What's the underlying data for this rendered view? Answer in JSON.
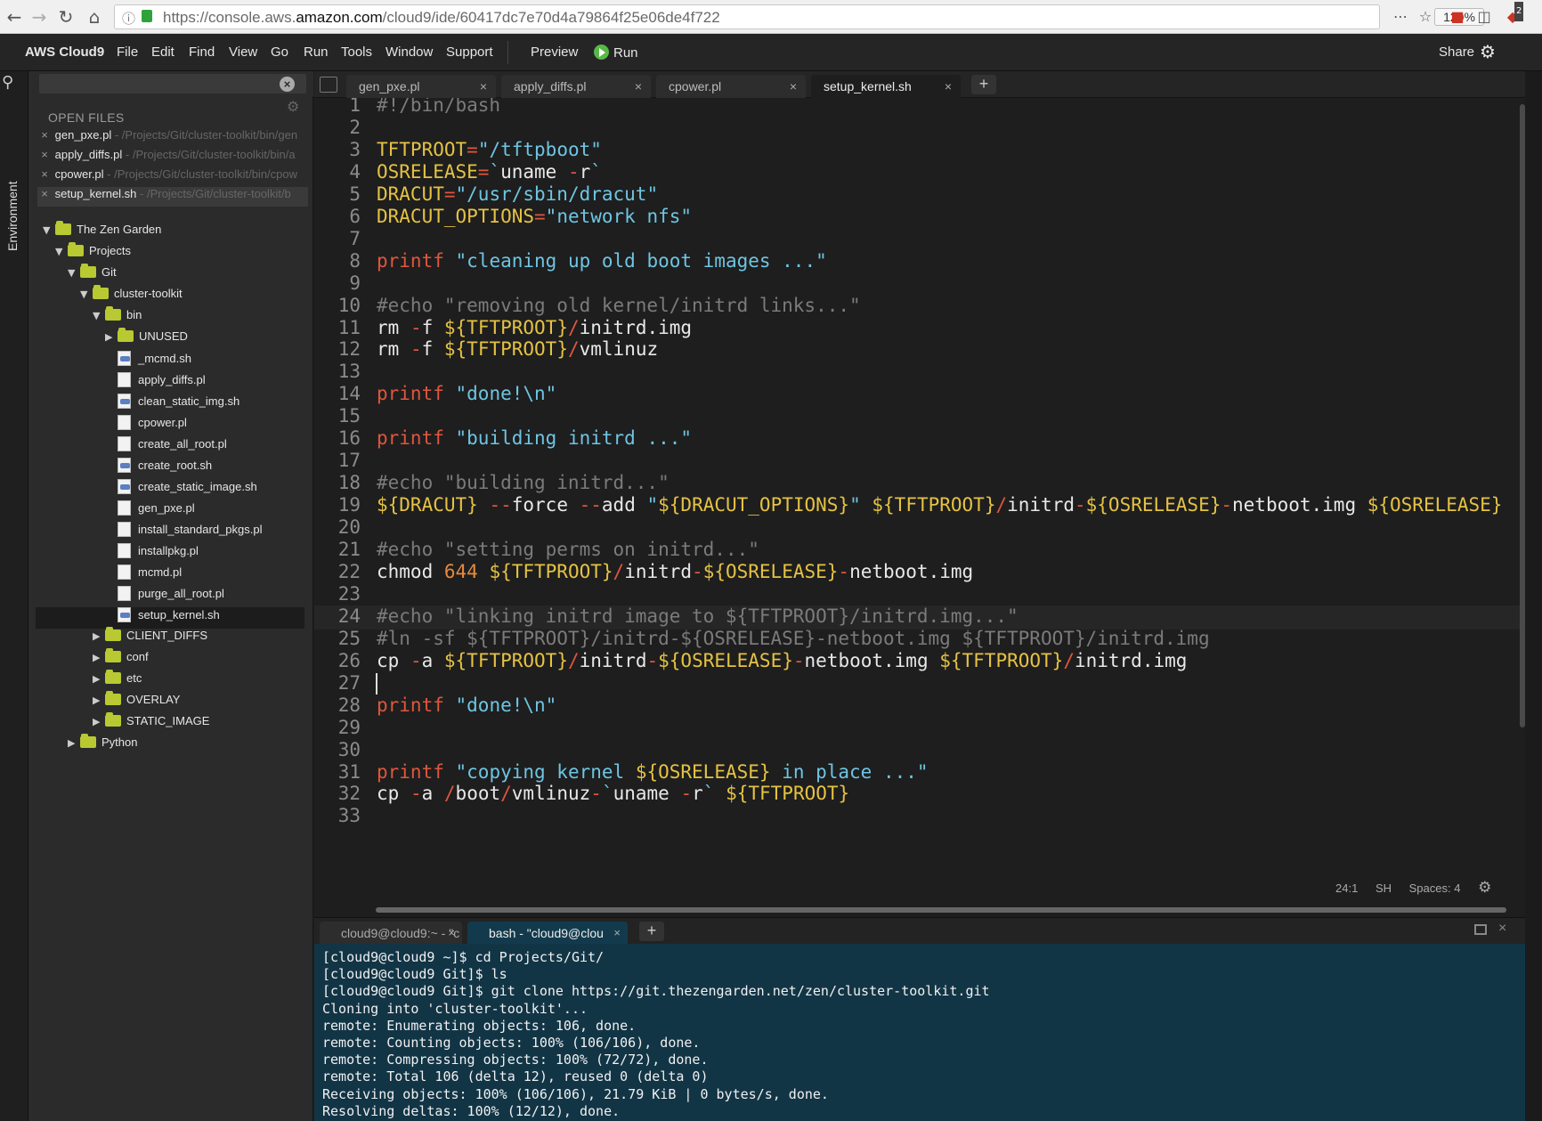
{
  "browser": {
    "url_prefix": "https://console.aws.",
    "url_domain": "amazon.com",
    "url_path": "/cloud9/ide/60417dc7e70d4a79864f25e06de4f722",
    "zoom": "120%",
    "badge": "2"
  },
  "menu": {
    "brand": "AWS Cloud9",
    "items": [
      "File",
      "Edit",
      "Find",
      "View",
      "Go",
      "Run",
      "Tools",
      "Window",
      "Support"
    ],
    "preview": "Preview",
    "run": "Run",
    "share": "Share"
  },
  "rail": {
    "environment": "Environment"
  },
  "sidebar": {
    "search_placeholder": "",
    "open_files_title": "OPEN FILES",
    "open_files": [
      {
        "name": "gen_pxe.pl",
        "path": " - /Projects/Git/cluster-toolkit/bin/gen"
      },
      {
        "name": "apply_diffs.pl",
        "path": " - /Projects/Git/cluster-toolkit/bin/a"
      },
      {
        "name": "cpower.pl",
        "path": " - /Projects/Git/cluster-toolkit/bin/cpow"
      },
      {
        "name": "setup_kernel.sh",
        "path": " - /Projects/Git/cluster-toolkit/b"
      }
    ],
    "tree": [
      {
        "label": "The Zen Garden",
        "type": "folder",
        "level": 0,
        "open": true
      },
      {
        "label": "Projects",
        "type": "folder",
        "level": 1,
        "open": true
      },
      {
        "label": "Git",
        "type": "folder",
        "level": 2,
        "open": true
      },
      {
        "label": "cluster-toolkit",
        "type": "folder",
        "level": 3,
        "open": true
      },
      {
        "label": "bin",
        "type": "folder",
        "level": 4,
        "open": true
      },
      {
        "label": "UNUSED",
        "type": "folder",
        "level": 5,
        "open": false
      },
      {
        "label": "_mcmd.sh",
        "type": "script",
        "level": 5
      },
      {
        "label": "apply_diffs.pl",
        "type": "file",
        "level": 5
      },
      {
        "label": "clean_static_img.sh",
        "type": "script",
        "level": 5
      },
      {
        "label": "cpower.pl",
        "type": "file",
        "level": 5
      },
      {
        "label": "create_all_root.pl",
        "type": "file",
        "level": 5
      },
      {
        "label": "create_root.sh",
        "type": "script",
        "level": 5
      },
      {
        "label": "create_static_image.sh",
        "type": "script",
        "level": 5
      },
      {
        "label": "gen_pxe.pl",
        "type": "file",
        "level": 5
      },
      {
        "label": "install_standard_pkgs.pl",
        "type": "file",
        "level": 5
      },
      {
        "label": "installpkg.pl",
        "type": "file",
        "level": 5
      },
      {
        "label": "mcmd.pl",
        "type": "file",
        "level": 5
      },
      {
        "label": "purge_all_root.pl",
        "type": "file",
        "level": 5
      },
      {
        "label": "setup_kernel.sh",
        "type": "script",
        "level": 5,
        "selected": true
      },
      {
        "label": "CLIENT_DIFFS",
        "type": "folder",
        "level": 4,
        "open": false
      },
      {
        "label": "conf",
        "type": "folder",
        "level": 4,
        "open": false
      },
      {
        "label": "etc",
        "type": "folder",
        "level": 4,
        "open": false
      },
      {
        "label": "OVERLAY",
        "type": "folder",
        "level": 4,
        "open": false
      },
      {
        "label": "STATIC_IMAGE",
        "type": "folder",
        "level": 4,
        "open": false
      },
      {
        "label": "Python",
        "type": "folder",
        "level": 2,
        "open": false
      }
    ]
  },
  "editor": {
    "tabs": [
      {
        "label": "gen_pxe.pl",
        "active": false
      },
      {
        "label": "apply_diffs.pl",
        "active": false
      },
      {
        "label": "cpower.pl",
        "active": false
      },
      {
        "label": "setup_kernel.sh",
        "active": true
      }
    ],
    "add_tab": "+",
    "current_line": 24,
    "lines": [
      [
        [
          "c",
          "#!/bin/bash"
        ]
      ],
      [],
      [
        [
          "v",
          "TFTPROOT"
        ],
        [
          "o",
          "="
        ],
        [
          "s",
          "\"/tftpboot\""
        ]
      ],
      [
        [
          "v",
          "OSRELEASE"
        ],
        [
          "o",
          "="
        ],
        [
          "s",
          "`"
        ],
        [
          "t",
          "uname "
        ],
        [
          "o",
          "-"
        ],
        [
          "t",
          "r"
        ],
        [
          "s",
          "`"
        ]
      ],
      [
        [
          "v",
          "DRACUT"
        ],
        [
          "o",
          "="
        ],
        [
          "s",
          "\"/usr/sbin/dracut\""
        ]
      ],
      [
        [
          "v",
          "DRACUT_OPTIONS"
        ],
        [
          "o",
          "="
        ],
        [
          "s",
          "\"network nfs\""
        ]
      ],
      [],
      [
        [
          "k",
          "printf"
        ],
        [
          "t",
          " "
        ],
        [
          "s",
          "\"cleaning up old boot images ...\""
        ]
      ],
      [],
      [
        [
          "c",
          "#echo \"removing old kernel/initrd links...\""
        ]
      ],
      [
        [
          "t",
          "rm "
        ],
        [
          "o",
          "-"
        ],
        [
          "t",
          "f "
        ],
        [
          "v",
          "${TFTPROOT}"
        ],
        [
          "o",
          "/"
        ],
        [
          "t",
          "initrd.img"
        ]
      ],
      [
        [
          "t",
          "rm "
        ],
        [
          "o",
          "-"
        ],
        [
          "t",
          "f "
        ],
        [
          "v",
          "${TFTPROOT}"
        ],
        [
          "o",
          "/"
        ],
        [
          "t",
          "vmlinuz"
        ]
      ],
      [],
      [
        [
          "k",
          "printf"
        ],
        [
          "t",
          " "
        ],
        [
          "s",
          "\"done!\\n\""
        ]
      ],
      [],
      [
        [
          "k",
          "printf"
        ],
        [
          "t",
          " "
        ],
        [
          "s",
          "\"building initrd ...\""
        ]
      ],
      [],
      [
        [
          "c",
          "#echo \"building initrd...\""
        ]
      ],
      [
        [
          "v",
          "${DRACUT}"
        ],
        [
          "t",
          " "
        ],
        [
          "o",
          "--"
        ],
        [
          "t",
          "force "
        ],
        [
          "o",
          "--"
        ],
        [
          "t",
          "add "
        ],
        [
          "s",
          "\""
        ],
        [
          "v",
          "${DRACUT_OPTIONS}"
        ],
        [
          "s",
          "\""
        ],
        [
          "t",
          " "
        ],
        [
          "v",
          "${TFTPROOT}"
        ],
        [
          "o",
          "/"
        ],
        [
          "t",
          "initrd"
        ],
        [
          "o",
          "-"
        ],
        [
          "v",
          "${OSRELEASE}"
        ],
        [
          "o",
          "-"
        ],
        [
          "t",
          "netboot.img "
        ],
        [
          "v",
          "${OSRELEASE}"
        ]
      ],
      [],
      [
        [
          "c",
          "#echo \"setting perms on initrd...\""
        ]
      ],
      [
        [
          "t",
          "chmod "
        ],
        [
          "n",
          "644"
        ],
        [
          "t",
          " "
        ],
        [
          "v",
          "${TFTPROOT}"
        ],
        [
          "o",
          "/"
        ],
        [
          "t",
          "initrd"
        ],
        [
          "o",
          "-"
        ],
        [
          "v",
          "${OSRELEASE}"
        ],
        [
          "o",
          "-"
        ],
        [
          "t",
          "netboot.img"
        ]
      ],
      [],
      [
        [
          "c",
          "#echo \"linking initrd image to ${TFTPROOT}/initrd.img...\""
        ]
      ],
      [
        [
          "c",
          "#ln -sf ${TFTPROOT}/initrd-${OSRELEASE}-netboot.img ${TFTPROOT}/initrd.img"
        ]
      ],
      [
        [
          "t",
          "cp "
        ],
        [
          "o",
          "-"
        ],
        [
          "t",
          "a "
        ],
        [
          "v",
          "${TFTPROOT}"
        ],
        [
          "o",
          "/"
        ],
        [
          "t",
          "initrd"
        ],
        [
          "o",
          "-"
        ],
        [
          "v",
          "${OSRELEASE}"
        ],
        [
          "o",
          "-"
        ],
        [
          "t",
          "netboot.img "
        ],
        [
          "v",
          "${TFTPROOT}"
        ],
        [
          "o",
          "/"
        ],
        [
          "t",
          "initrd.img"
        ]
      ],
      [],
      [
        [
          "k",
          "printf"
        ],
        [
          "t",
          " "
        ],
        [
          "s",
          "\"done!\\n\""
        ]
      ],
      [],
      [],
      [
        [
          "k",
          "printf"
        ],
        [
          "t",
          " "
        ],
        [
          "s",
          "\"copying kernel "
        ],
        [
          "v",
          "${OSRELEASE}"
        ],
        [
          "s",
          " in place ...\""
        ]
      ],
      [
        [
          "t",
          "cp "
        ],
        [
          "o",
          "-"
        ],
        [
          "t",
          "a "
        ],
        [
          "o",
          "/"
        ],
        [
          "t",
          "boot"
        ],
        [
          "o",
          "/"
        ],
        [
          "t",
          "vmlinuz"
        ],
        [
          "o",
          "-"
        ],
        [
          "s",
          "`"
        ],
        [
          "t",
          "uname "
        ],
        [
          "o",
          "-"
        ],
        [
          "t",
          "r"
        ],
        [
          "s",
          "`"
        ],
        [
          "t",
          " "
        ],
        [
          "v",
          "${TFTPROOT}"
        ]
      ],
      []
    ],
    "status": {
      "position": "24:1",
      "mode": "SH",
      "spaces": "Spaces: 4"
    }
  },
  "terminal": {
    "tabs": [
      {
        "label": "cloud9@cloud9:~ - \"c",
        "active": false
      },
      {
        "label": "bash - \"cloud9@clou",
        "active": true
      }
    ],
    "lines": [
      "[cloud9@cloud9 ~]$ cd Projects/Git/",
      "[cloud9@cloud9 Git]$ ls",
      "[cloud9@cloud9 Git]$ git clone https://git.thezengarden.net/zen/cluster-toolkit.git",
      "Cloning into 'cluster-toolkit'...",
      "remote: Enumerating objects: 106, done.",
      "remote: Counting objects: 100% (106/106), done.",
      "remote: Compressing objects: 100% (72/72), done.",
      "remote: Total 106 (delta 12), reused 0 (delta 0)",
      "Receiving objects: 100% (106/106), 21.79 KiB | 0 bytes/s, done.",
      "Resolving deltas: 100% (12/12), done."
    ]
  }
}
